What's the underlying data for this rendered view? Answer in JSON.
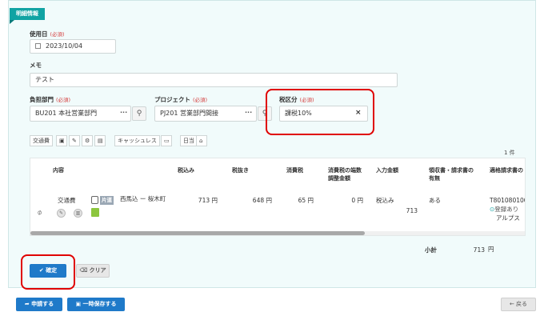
{
  "section": {
    "title": "明細情報"
  },
  "labels": {
    "required": "(必須)",
    "use_date": "使用日",
    "memo": "メモ",
    "department": "負担部門",
    "project": "プロジェクト",
    "tax": "税区分"
  },
  "fields": {
    "use_date": "2023/10/04",
    "memo": "テスト",
    "department": "BU201 本社営業部門",
    "project": "PJ201 営業部門間接",
    "tax": "課税10%"
  },
  "toolbar": {
    "transport": "交通費",
    "cashless": "キャッシュレス",
    "daily": "日当"
  },
  "count": "1 件",
  "table": {
    "headers": {
      "content": "内容",
      "tax_in": "税込み",
      "tax_out": "税抜き",
      "tax": "消費税",
      "adjust": "消費税の端数\n調整金額",
      "input_amount": "入力金額",
      "receipt": "領収書・請求書の\n有無",
      "invoice": "適格請求書の"
    },
    "row": {
      "type": "交通費",
      "badge": "片道",
      "route": "西馬込 ー 桜木町",
      "tax_in": "713 円",
      "tax_out": "648 円",
      "tax": "65 円",
      "adjust": "0 円",
      "input_mode": "税込み",
      "input_amount": "713",
      "receipt": "ある",
      "invoice_no": "T801080100",
      "invoice_status": "登録あり",
      "invoice_name": "アルプス"
    }
  },
  "subtotal": {
    "label": "小計",
    "value": "713",
    "unit": "円"
  },
  "buttons": {
    "confirm": "確定",
    "clear": "クリア",
    "apply": "申請する",
    "save_draft": "一時保存する",
    "back": "戻る"
  },
  "colors": {
    "accent": "#11a3a3",
    "primary": "#1f7ac9",
    "highlight": "#e00000"
  }
}
